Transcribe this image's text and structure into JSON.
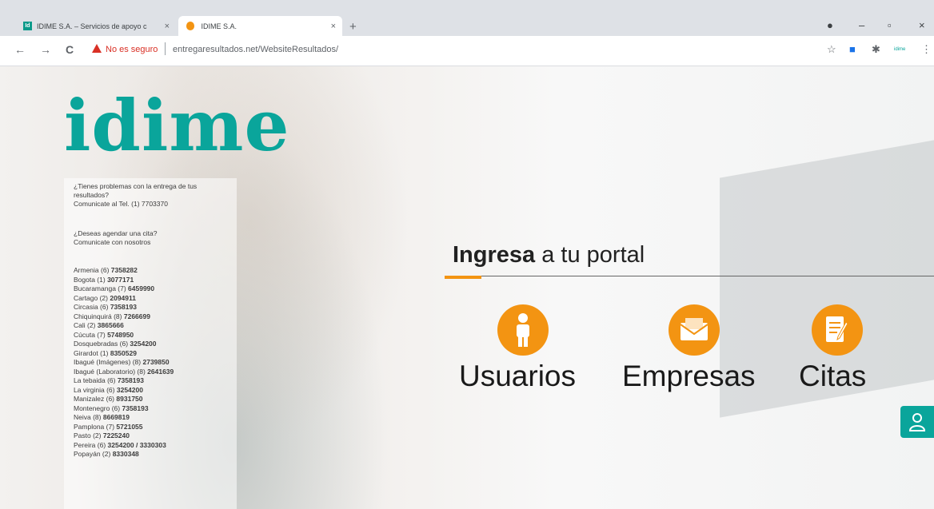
{
  "browser": {
    "tabs": [
      {
        "title": "IDIME S.A. – Servicios de apoyo c",
        "favicon": "idime-favicon",
        "active": false
      },
      {
        "title": "IDIME S.A.",
        "favicon": "idime-orange-favicon",
        "active": true
      }
    ],
    "tab_close": "×",
    "new_tab": "+",
    "window_controls": {
      "minimize": "–",
      "maximize": "▫",
      "close": "×"
    },
    "nav": {
      "back": "←",
      "forward": "→",
      "reload": "C"
    },
    "security_text": "No es seguro",
    "url": "entregaresultados.net/WebsiteResultados/"
  },
  "page": {
    "logo_text": "idime",
    "problem_text": "¿Tienes problemas con la entrega de tus resultados?",
    "problem_contact": "Comunicate al Tel. (1) 7703370",
    "schedule_text": "¿Deseas agendar una cita?",
    "schedule_contact": "Comunicate con nosotros",
    "cities": [
      {
        "name": "Armenia (6)",
        "phone": "7358282"
      },
      {
        "name": "Bogota (1)",
        "phone": "3077171"
      },
      {
        "name": "Bucaramanga (7)",
        "phone": "6459990"
      },
      {
        "name": "Cartago (2)",
        "phone": "2094911"
      },
      {
        "name": "Circasia (6)",
        "phone": "7358193"
      },
      {
        "name": "Chiquinquirá (8)",
        "phone": "7266699"
      },
      {
        "name": "Cali (2)",
        "phone": "3865666"
      },
      {
        "name": "Cúcuta (7)",
        "phone": "5748950"
      },
      {
        "name": "Dosquebradas (6)",
        "phone": "3254200"
      },
      {
        "name": "Girardot (1)",
        "phone": "8350529"
      },
      {
        "name": "Ibagué (Imágenes) (8)",
        "phone": "2739850"
      },
      {
        "name": "Ibagué (Laboratorio) (8)",
        "phone": "2641639"
      },
      {
        "name": "La tebaida (6)",
        "phone": "7358193"
      },
      {
        "name": "La virginia (6)",
        "phone": "3254200"
      },
      {
        "name": "Manizalez (6)",
        "phone": "8931750"
      },
      {
        "name": "Montenegro (6)",
        "phone": "7358193"
      },
      {
        "name": "Neiva (8)",
        "phone": "8669819"
      },
      {
        "name": "Pamplona (7)",
        "phone": "5721055"
      },
      {
        "name": "Pasto (2)",
        "phone": "7225240"
      },
      {
        "name": "Pereira (6)",
        "phone": "3254200 / 3330303"
      },
      {
        "name": "Popayán (2)",
        "phone": "8330348"
      }
    ],
    "portal_heading_bold": "Ingresa",
    "portal_heading_rest": " a tu portal",
    "options": [
      {
        "label": "Usuarios",
        "icon": "person-icon"
      },
      {
        "label": "Empresas",
        "icon": "envelope-icon"
      },
      {
        "label": "Citas",
        "icon": "clipboard-edit-icon"
      }
    ],
    "accent_color": "#f39412",
    "brand_color": "#0aa59b"
  }
}
